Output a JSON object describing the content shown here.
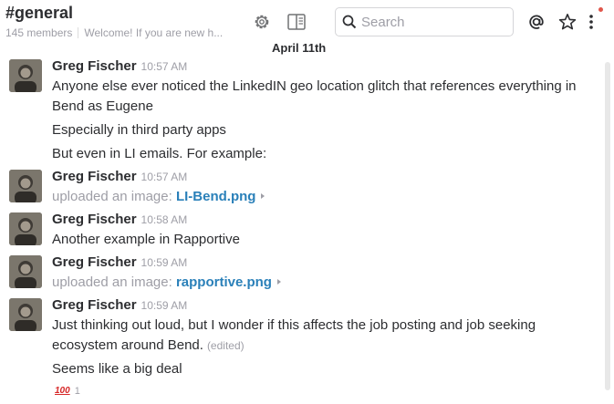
{
  "header": {
    "channel_name": "#general",
    "member_count": "145 members",
    "topic": "Welcome! If you are new h...",
    "search_placeholder": "Search",
    "icons": [
      "gear-icon",
      "sidebar-toggle-icon",
      "search-icon",
      "mentions-icon",
      "star-icon",
      "more-icon"
    ],
    "notification_color": "#e0564b"
  },
  "date_divider": "April 11th",
  "messages": [
    {
      "author": "Greg Fischer",
      "time": "10:57 AM",
      "lines": [
        "Anyone else ever noticed the LinkedIN geo location glitch that references everything in Bend as Eugene",
        "Especially in third party apps",
        "But even in LI emails. For example:"
      ]
    },
    {
      "author": "Greg Fischer",
      "time": "10:57 AM",
      "upload_prefix": "uploaded an image:",
      "file": "LI-Bend.png"
    },
    {
      "author": "Greg Fischer",
      "time": "10:58 AM",
      "lines": [
        "Another example in Rapportive"
      ]
    },
    {
      "author": "Greg Fischer",
      "time": "10:59 AM",
      "upload_prefix": "uploaded an image:",
      "file": "rapportive.png"
    },
    {
      "author": "Greg Fischer",
      "time": "10:59 AM",
      "lines": [
        "Just thinking out loud, but I wonder if this affects the job posting and job seeking ecosystem around Bend.",
        "Seems like a big deal"
      ],
      "edited_label": "(edited)",
      "reaction": {
        "emoji": "100",
        "count": "1"
      }
    }
  ],
  "colors": {
    "link": "#2a80b9",
    "muted": "#9e9ea6",
    "text": "#2c2d30"
  }
}
